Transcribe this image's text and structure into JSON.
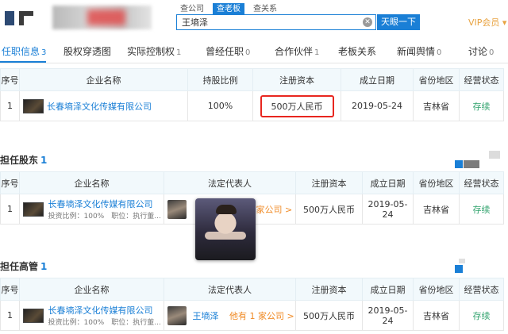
{
  "header": {
    "search_tabs": [
      "查公司",
      "查老板",
      "查关系"
    ],
    "active_search_tab": 1,
    "search_value": "王墒泽",
    "search_button": "天眼一下",
    "vip_label": "VIP会员 ▾"
  },
  "tabs": [
    {
      "label": "任职信息",
      "count": "3"
    },
    {
      "label": "股权穿透图",
      "count": ""
    },
    {
      "label": "实际控制权",
      "count": "1"
    },
    {
      "label": "曾经任职",
      "count": "0"
    },
    {
      "label": "合作伙伴",
      "count": "1"
    },
    {
      "label": "老板关系",
      "count": ""
    },
    {
      "label": "新闻舆情",
      "count": "0"
    },
    {
      "label": "讨论",
      "count": "0"
    }
  ],
  "table1": {
    "headers": [
      "序号",
      "企业名称",
      "持股比例",
      "注册资本",
      "成立日期",
      "省份地区",
      "经营状态"
    ],
    "row": {
      "index": "1",
      "company": "长春墒泽文化传媒有限公司",
      "ratio": "100%",
      "capital": "500万人民币",
      "date": "2019-05-24",
      "region": "吉林省",
      "status": "存续"
    }
  },
  "section2": {
    "title": "担任股东",
    "count": "1"
  },
  "table2": {
    "headers": [
      "序号",
      "企业名称",
      "法定代表人",
      "注册资本",
      "成立日期",
      "省份地区",
      "经营状态"
    ],
    "row": {
      "index": "1",
      "company": "长春墒泽文化传媒有限公司",
      "sub": "投资比例：100%　职位：执行董...",
      "rep_link": "家公司 >",
      "capital": "500万人民币",
      "date": "2019-05-24",
      "region": "吉林省",
      "status": "存续"
    }
  },
  "section3": {
    "title": "担任高管",
    "count": "1"
  },
  "table3": {
    "headers": [
      "序号",
      "企业名称",
      "法定代表人",
      "注册资本",
      "成立日期",
      "省份地区",
      "经营状态"
    ],
    "row": {
      "index": "1",
      "company": "长春墒泽文化传媒有限公司",
      "sub": "投资比例：100%　职位：执行董...",
      "rep_name": "王墒泽",
      "rep_link": "他有 1 家公司 >",
      "capital": "500万人民币",
      "date": "2019-05-24",
      "region": "吉林省",
      "status": "存续"
    }
  },
  "colors": {
    "accent": "#1a7fd6",
    "status": "#2fa26c",
    "highlight": "#e8261f",
    "vip": "#e8a341"
  }
}
